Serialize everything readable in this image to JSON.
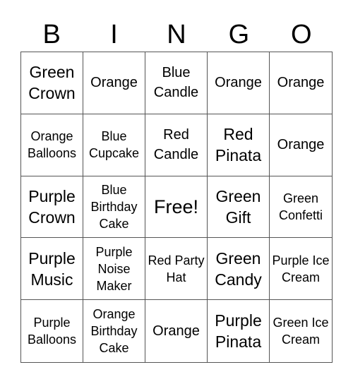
{
  "header": [
    "B",
    "I",
    "N",
    "G",
    "O"
  ],
  "cells": [
    "Green Crown",
    "Orange",
    "Blue Candle",
    "Orange",
    "Orange",
    "Orange Balloons",
    "Blue Cupcake",
    "Red Candle",
    "Red Pinata",
    "Orange",
    "Purple Crown",
    "Blue Birthday Cake",
    "Free!",
    "Green Gift",
    "Green Confetti",
    "Purple Music",
    "Purple Noise Maker",
    "Red Party Hat",
    "Green Candy",
    "Purple Ice Cream",
    "Purple Balloons",
    "Orange Birthday Cake",
    "Orange",
    "Purple Pinata",
    "Green Ice Cream"
  ]
}
